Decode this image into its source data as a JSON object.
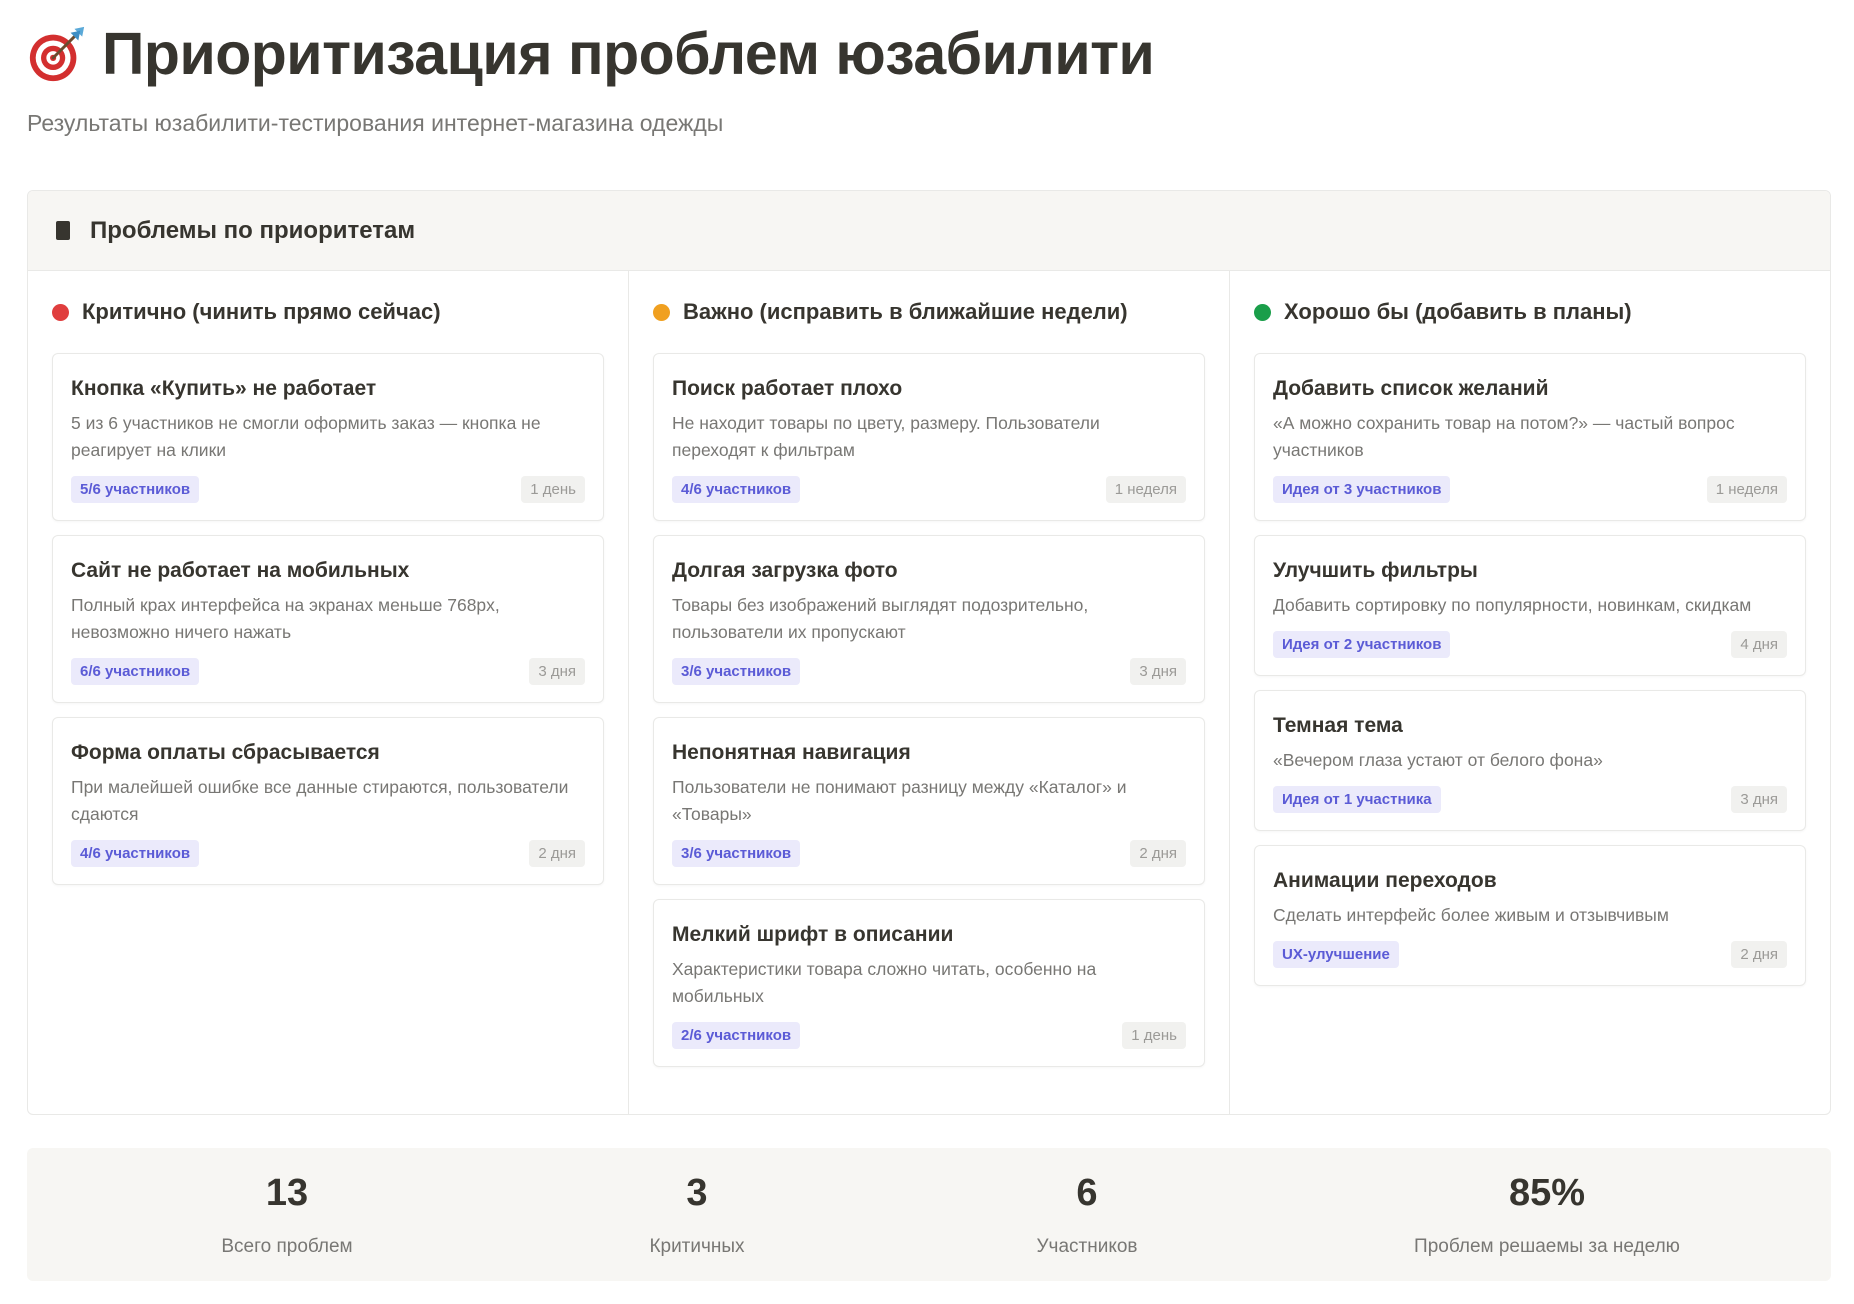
{
  "page": {
    "icon": "target-dart-icon",
    "title": "Приоритизация проблем юзабилити",
    "subtitle": "Результаты юзабилити-тестирования интернет-магазина одежды"
  },
  "board": {
    "icon": "black-square-icon",
    "title": "Проблемы по приоритетам",
    "columns": [
      {
        "title": "Критично (чинить прямо сейчас)",
        "color": "#e03e3e",
        "cards": [
          {
            "title": "Кнопка «Купить» не работает",
            "desc": "5 из 6 участников не смогли оформить заказ — кнопка не реагирует на клики",
            "badge": "5/6 участников",
            "duration": "1 день"
          },
          {
            "title": "Сайт не работает на мобильных",
            "desc": "Полный крах интерфейса на экранах меньше 768px, невозможно ничего нажать",
            "badge": "6/6 участников",
            "duration": "3 дня"
          },
          {
            "title": "Форма оплаты сбрасывается",
            "desc": "При малейшей ошибке все данные стираются, пользователи сдаются",
            "badge": "4/6 участников",
            "duration": "2 дня"
          }
        ]
      },
      {
        "title": "Важно (исправить в ближайшие недели)",
        "color": "#f0a020",
        "cards": [
          {
            "title": "Поиск работает плохо",
            "desc": "Не находит товары по цвету, размеру. Пользователи переходят к фильтрам",
            "badge": "4/6 участников",
            "duration": "1 неделя"
          },
          {
            "title": "Долгая загрузка фото",
            "desc": "Товары без изображений выглядят подозрительно, пользователи их пропускают",
            "badge": "3/6 участников",
            "duration": "3 дня"
          },
          {
            "title": "Непонятная навигация",
            "desc": "Пользователи не понимают разницу между «Каталог» и «Товары»",
            "badge": "3/6 участников",
            "duration": "2 дня"
          },
          {
            "title": "Мелкий шрифт в описании",
            "desc": "Характеристики товара сложно читать, особенно на мобильных",
            "badge": "2/6 участников",
            "duration": "1 день"
          }
        ]
      },
      {
        "title": "Хорошо бы (добавить в планы)",
        "color": "#1a9e4a",
        "cards": [
          {
            "title": "Добавить список желаний",
            "desc": "«А можно сохранить товар на потом?» — частый вопрос участников",
            "badge": "Идея от 3 участников",
            "duration": "1 неделя"
          },
          {
            "title": "Улучшить фильтры",
            "desc": "Добавить сортировку по популярности, новинкам, скидкам",
            "badge": "Идея от 2 участников",
            "duration": "4 дня"
          },
          {
            "title": "Темная тема",
            "desc": "«Вечером глаза устают от белого фона»",
            "badge": "Идея от 1 участника",
            "duration": "3 дня"
          },
          {
            "title": "Анимации переходов",
            "desc": "Сделать интерфейс более живым и отзывчивым",
            "badge": "UX-улучшение",
            "duration": "2 дня"
          }
        ]
      }
    ]
  },
  "stats": [
    {
      "value": "13",
      "label": "Всего проблем"
    },
    {
      "value": "3",
      "label": "Критичных"
    },
    {
      "value": "6",
      "label": "Участников"
    },
    {
      "value": "85%",
      "label": "Проблем решаемы за неделю"
    }
  ]
}
